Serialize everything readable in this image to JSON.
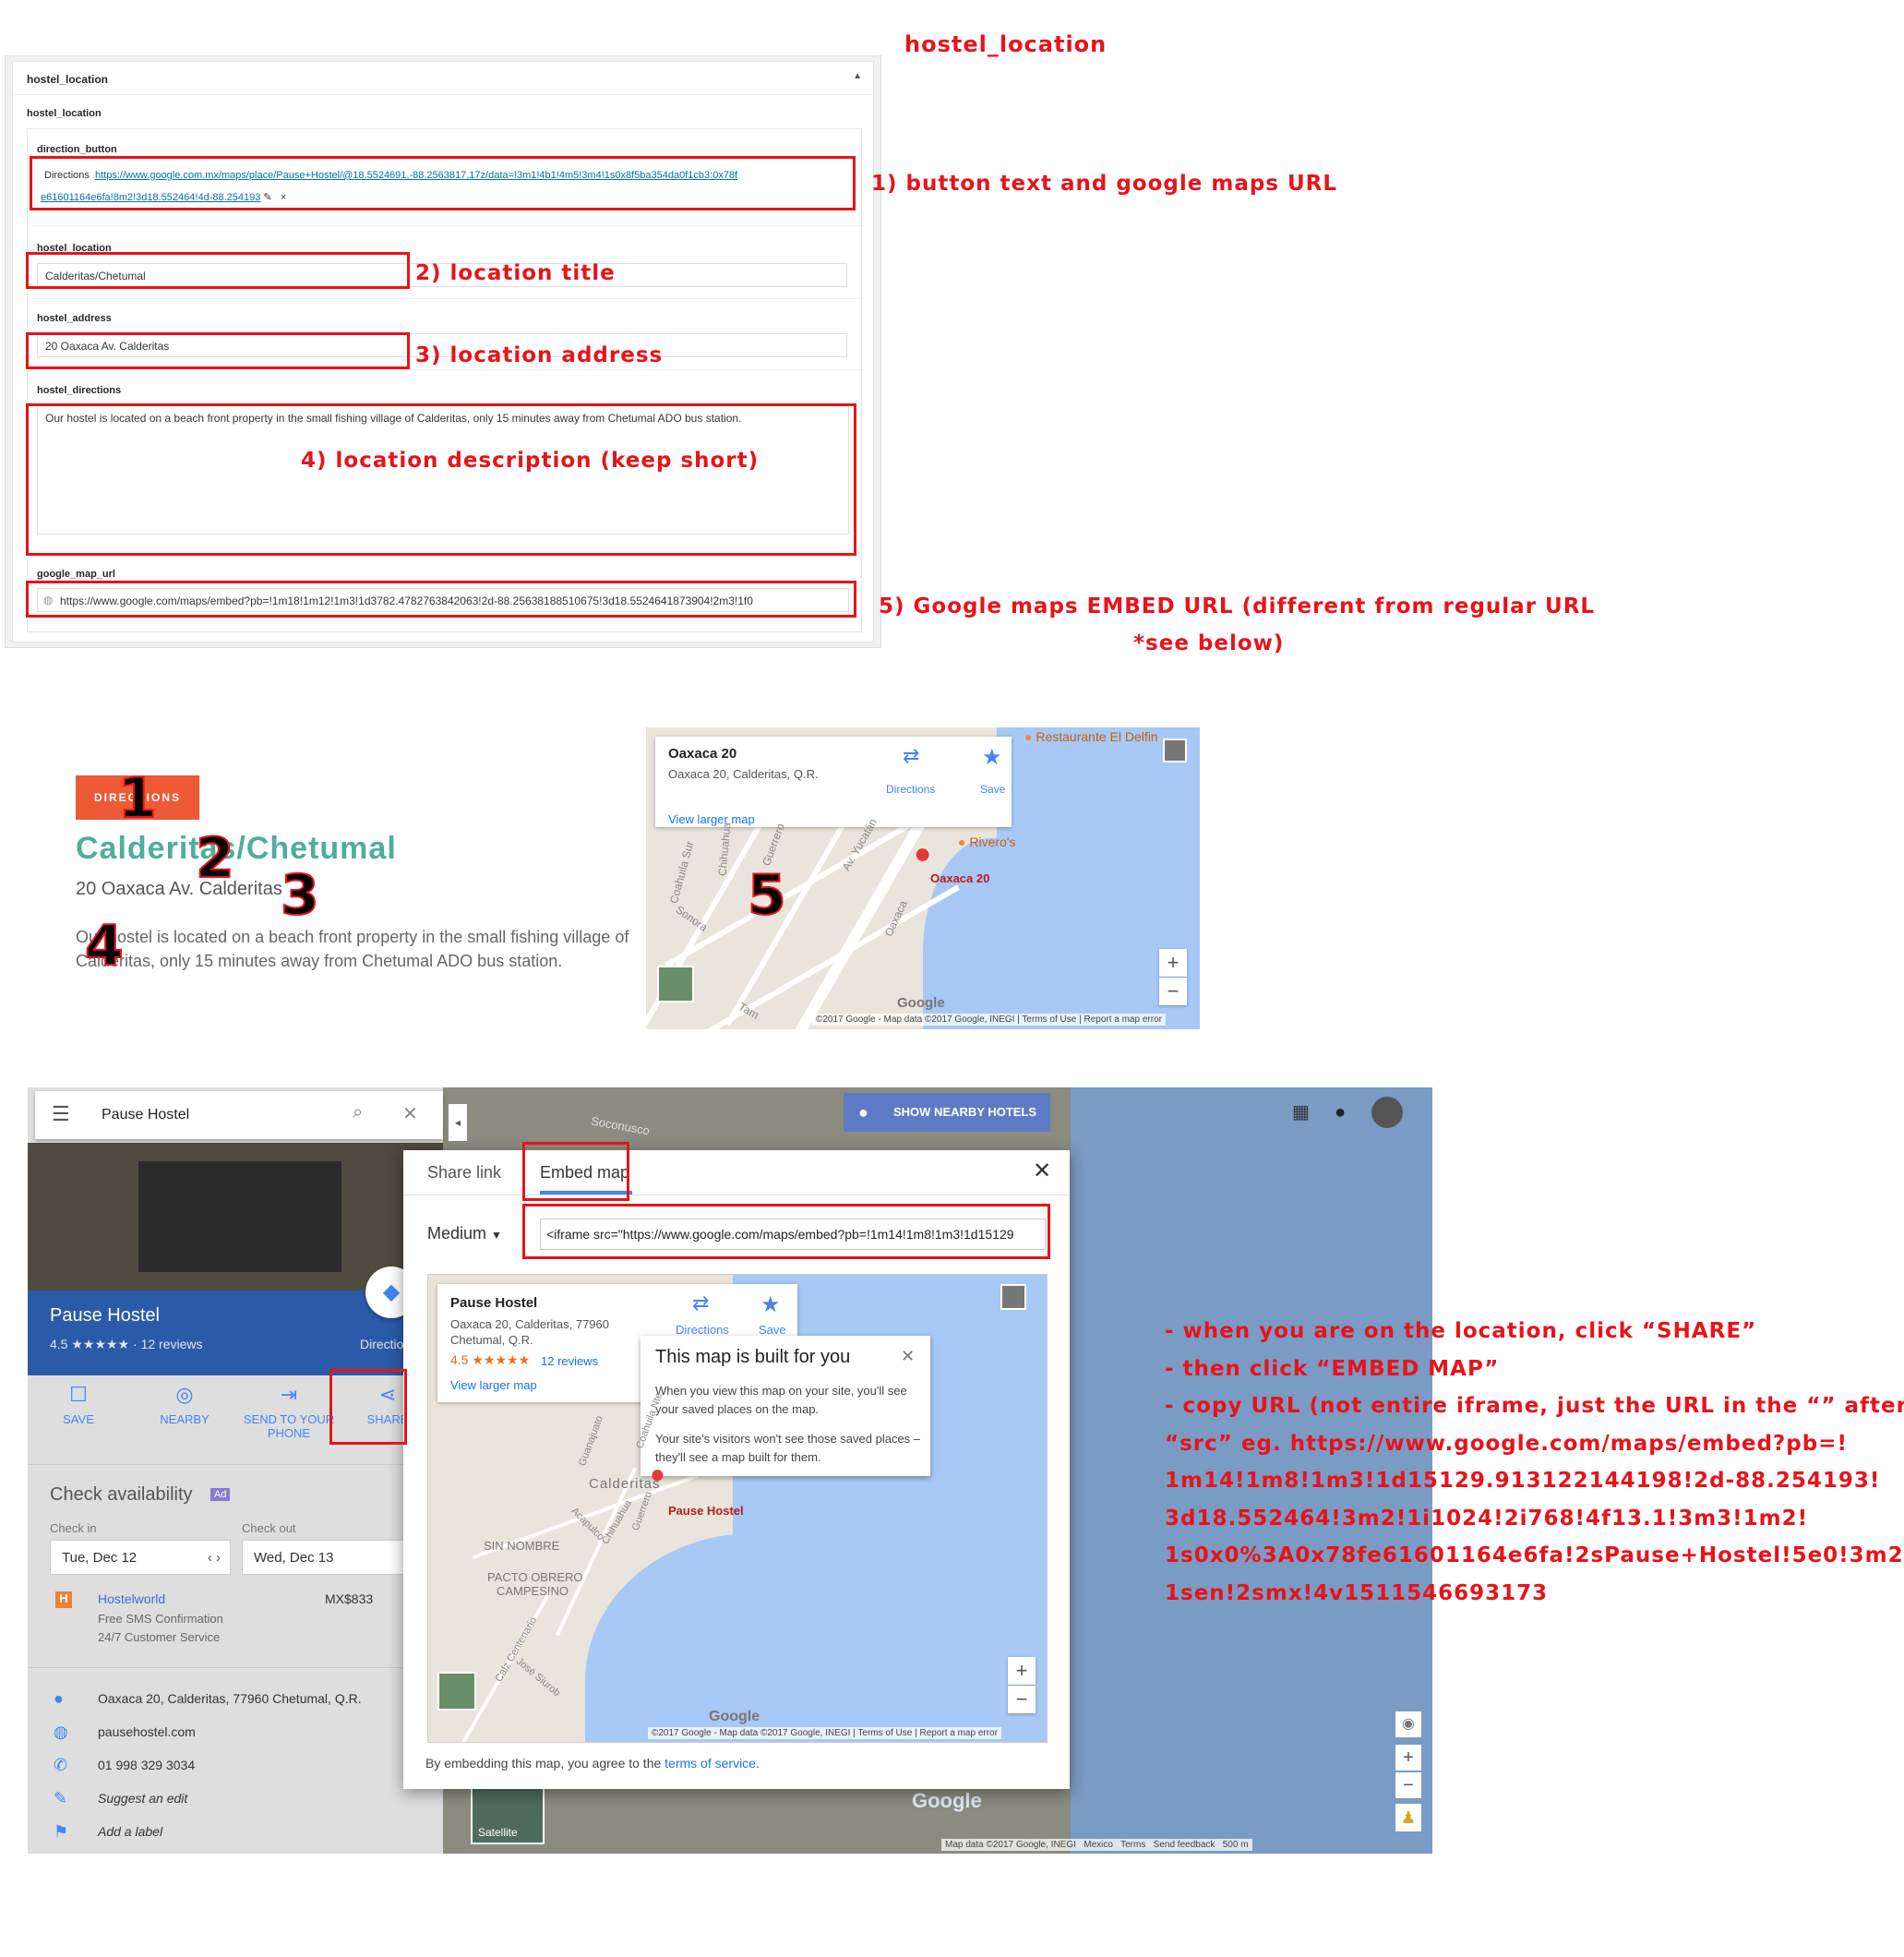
{
  "title_annotation": "hostel_location",
  "acf": {
    "panel_title": "hostel_location",
    "group_label": "hostel_location",
    "direction_button_label": "direction_button",
    "direction_text": "Directions",
    "direction_url_line1": "https://www.google.com.mx/maps/place/Pause+Hostel/@18.5524691,-88.2563817,17z/data=!3m1!4b1!4m5!3m4!1s0x8f5ba354da0f1cb3:0x78f",
    "direction_url_line2": "e61601164e6fa!8m2!3d18.552464!4d-88.254193",
    "edit_icon": "✎",
    "remove_icon": "×",
    "location_label": "hostel_location",
    "location_value": "Calderitas/Chetumal",
    "address_label": "hostel_address",
    "address_value": "20 Oaxaca Av. Calderitas",
    "directions_label": "hostel_directions",
    "directions_value": "Our hostel is located on a beach front property in the small fishing village of Calderitas, only 15 minutes away from Chetumal ADO bus station.",
    "map_url_label": "google_map_url",
    "map_url_value": "https://www.google.com/maps/embed?pb=!1m18!1m12!1m3!1d3782.4782763842063!2d-88.25638188510675!3d18.5524641873904!2m3!1f0"
  },
  "annotations": {
    "a1": "1) button text and google maps URL",
    "a2": "2) location title",
    "a3": "3) location address",
    "a4": "4) location description (keep short)",
    "a5_line1": "5) Google maps EMBED URL (different from regular URL",
    "a5_line2": "*see below)"
  },
  "frontend": {
    "button": "DIRECTIONS",
    "title": "Calderitas/Chetumal",
    "address": "20 Oaxaca Av. Calderitas",
    "description_line1": "Our hostel is located on a beach front property in the small fishing village of",
    "description_line2": "Calderitas, only 15 minutes away from Chetumal ADO bus station.",
    "markers": [
      "1",
      "2",
      "3",
      "4",
      "5"
    ]
  },
  "map_embed": {
    "place": "Oaxaca 20",
    "place_address": "Oaxaca 20, Calderitas, Q.R.",
    "directions": "Directions",
    "save": "Save",
    "view_larger": "View larger map",
    "poi1": "Restaurante El Delfin",
    "poi2": "Rivero's",
    "pin_label": "Oaxaca 20",
    "streets": [
      "Coahuila Sur",
      "Chihuahua",
      "Guerrero",
      "Av. Yucatán",
      "Sonora",
      "Oaxaca",
      "Tam"
    ],
    "google": "Google",
    "footer": [
      "©2017 Google - Map data ©2017 Google, INEGI",
      "Terms of Use",
      "Report a map error"
    ]
  },
  "gmaps": {
    "search": "Pause Hostel",
    "nearby_hotels": "SHOW NEARBY HOTELS",
    "place_name": "Pause Hostel",
    "rating": "4.5",
    "stars": "★★★★★",
    "reviews": "· 12 reviews",
    "directions_short": "Directio",
    "actions": [
      "SAVE",
      "NEARBY",
      "SEND TO YOUR PHONE",
      "SHARE"
    ],
    "check_availability": "Check availability",
    "ad": "Ad",
    "check_in": "Check in",
    "check_out": "Check out",
    "check_in_value": "Tue, Dec 12",
    "check_out_value": "Wed, Dec 13",
    "provider": "Hostelworld",
    "price": "MX$833",
    "provider_note1": "Free SMS Confirmation",
    "provider_note2": "24/7 Customer Service",
    "info": [
      "Oaxaca 20, Calderitas, 77960 Chetumal, Q.R.",
      "pausehostel.com",
      "01 998 329 3034",
      "Suggest an edit",
      "Add a label"
    ],
    "satellite": "Satellite",
    "street_top": "Soconusco",
    "google": "Google",
    "footer": [
      "Map data ©2017 Google, INEGI",
      "Mexico",
      "Terms",
      "Send feedback",
      "500 m"
    ]
  },
  "dialog": {
    "tab_share": "Share link",
    "tab_embed": "Embed map",
    "size": "Medium",
    "iframe": "<iframe src=\"https://www.google.com/maps/embed?pb=!1m14!1m8!1m3!1d15129",
    "card_title": "Pause Hostel",
    "card_address1": "Oaxaca 20, Calderitas, 77960",
    "card_address2": "Chetumal, Q.R.",
    "card_rating": "4.5",
    "card_stars": "★★★★★",
    "card_reviews": "12 reviews",
    "card_directions": "Directions",
    "card_save": "Save",
    "card_view_larger": "View larger map",
    "tip_title": "This map is built for you",
    "tip_p1": "When you view this map on your site, you'll see your saved places on the map.",
    "tip_p2": "Your site's visitors won't see those saved places – they'll see a map built for them.",
    "area_labels": [
      "Calderitas",
      "SIN NOMBRE",
      "PACTO OBRERO",
      "CAMPESINO",
      "Guanajuato",
      "Acapulco",
      "Chihuahua",
      "Guerrero",
      "Calz Centenario",
      "José Siurob",
      "Coahuila Nte"
    ],
    "pin_label": "Pause Hostel",
    "google": "Google",
    "footer": [
      "©2017 Google - Map data ©2017 Google, INEGI",
      "Terms of Use",
      "Report a map error"
    ],
    "tos_prefix": "By embedding this map, you agree to the ",
    "tos_link": "terms of service",
    "tos_suffix": "."
  },
  "instructions": [
    "- when you are on the location, click “SHARE”",
    "- then click “EMBED MAP”",
    "- copy URL (not entire iframe, just the URL in the “” after",
    "“src” eg. https://www.google.com/maps/embed?pb=!",
    "1m14!1m8!1m3!1d15129.91312214419​8!2d-88.254193!",
    "3d18.552464!3m2!1i1024!2i768!4f13.1!3m3!1m2!",
    "1s0x0%3A0x78fe61601164e6fa!2sPause+Hostel!5e0!3m2!",
    "1sen!2smx!4v1511546693173"
  ],
  "colors": {
    "annotation": "#e8131a",
    "button": "#ee5a36",
    "title": "#4fae9a",
    "gmaps_blue": "#4285f4"
  }
}
